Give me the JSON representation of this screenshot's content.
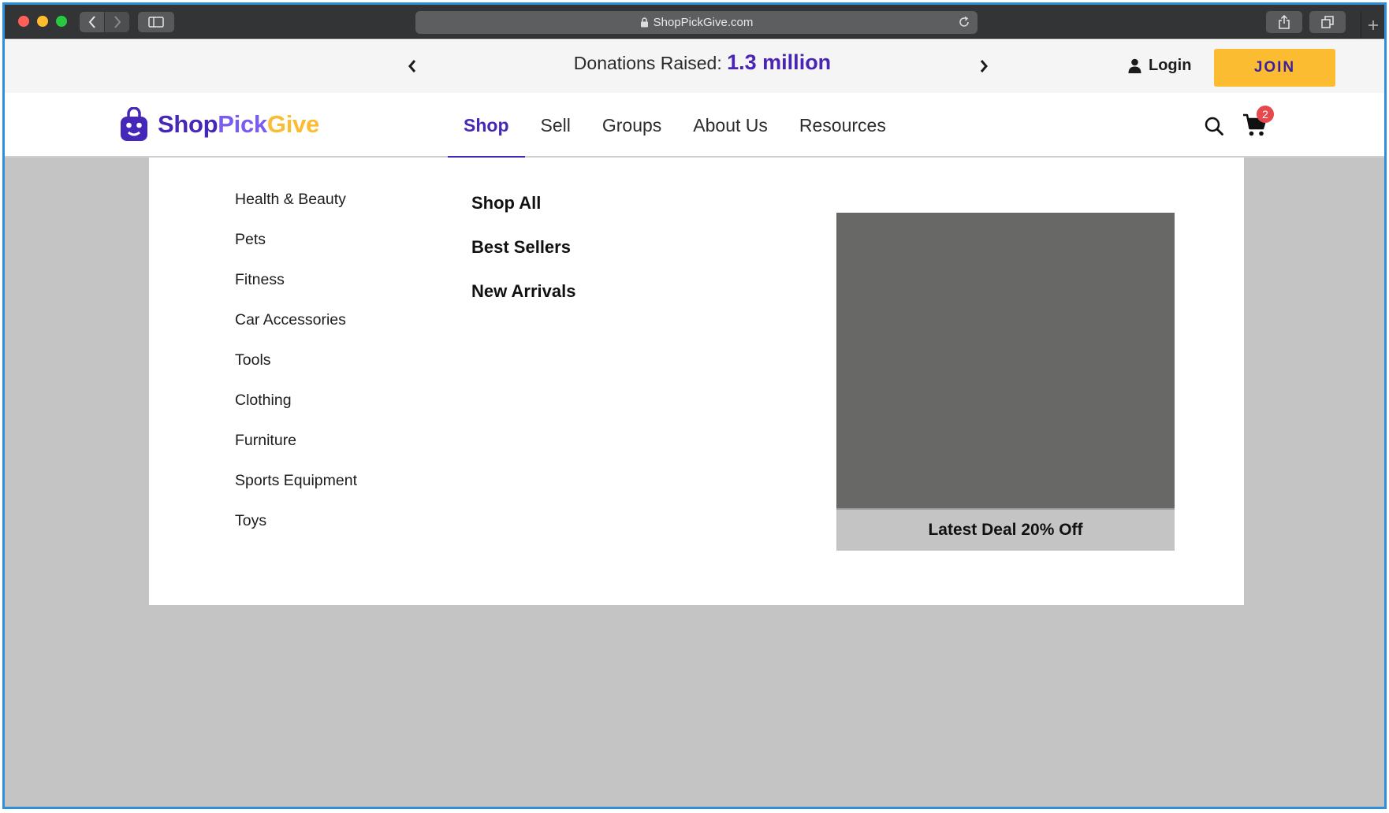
{
  "browser": {
    "url": "ShopPickGive.com"
  },
  "promo": {
    "label": "Donations Raised:",
    "value": "1.3 million",
    "login_label": "Login",
    "join_label": "JOIN"
  },
  "brand": {
    "part1": "Shop",
    "part2": "Pick",
    "part3": "Give"
  },
  "nav": {
    "items": [
      {
        "label": "Shop",
        "active": true
      },
      {
        "label": "Sell"
      },
      {
        "label": "Groups"
      },
      {
        "label": "About Us"
      },
      {
        "label": "Resources"
      }
    ],
    "cart_count": "2"
  },
  "dropdown": {
    "categories": [
      "Health & Beauty",
      "Pets",
      "Fitness",
      "Car Accessories",
      "Tools",
      "Clothing",
      "Furniture",
      "Sports Equipment",
      "Toys"
    ],
    "quick_links": [
      "Shop All",
      "Best Sellers",
      "New Arrivals"
    ],
    "deal_label": "Latest Deal 20% Off"
  },
  "colors": {
    "brand_purple": "#4528b8",
    "brand_yellow": "#fbbc31",
    "badge_red": "#e5484d"
  }
}
